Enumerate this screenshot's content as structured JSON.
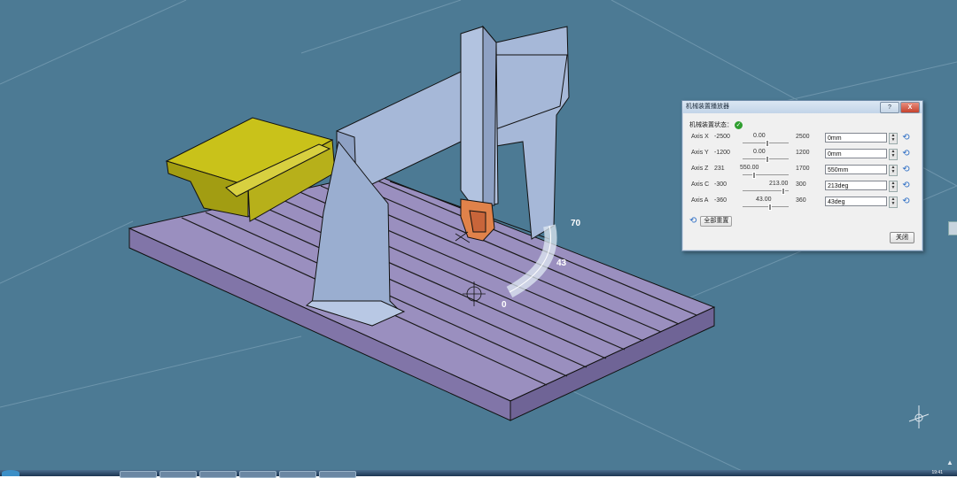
{
  "window": {
    "title": "机械装置播放器"
  },
  "title_buttons": {
    "help": "?",
    "close": "X"
  },
  "status": {
    "label": "机械装置状态：",
    "ok_icon": "checkmark-icon"
  },
  "axes": [
    {
      "name": "Axis X",
      "min": "-2500",
      "value": "0.00",
      "max": "2500",
      "input": "0mm",
      "slider_fraction": 0.5
    },
    {
      "name": "Axis Y",
      "min": "-1200",
      "value": "0.00",
      "max": "1200",
      "input": "0mm",
      "slider_fraction": 0.5
    },
    {
      "name": "Axis Z",
      "min": "231",
      "value": "550.00",
      "max": "1700",
      "input": "550mm",
      "slider_fraction": 0.22
    },
    {
      "name": "Axis C",
      "min": "-300",
      "value": "213.00",
      "max": "300",
      "input": "213deg",
      "slider_fraction": 0.85
    },
    {
      "name": "Axis A",
      "min": "-360",
      "value": "43.00",
      "max": "360",
      "input": "43deg",
      "slider_fraction": 0.56
    }
  ],
  "reset_all": {
    "label": "全部重置"
  },
  "close_button": {
    "label": "关闭"
  },
  "viewport": {
    "background": "#4c7a94",
    "dial_labels": {
      "top": "70",
      "bottom": "0",
      "mid": "43"
    }
  },
  "taskbar": {
    "clock": "19:41"
  }
}
